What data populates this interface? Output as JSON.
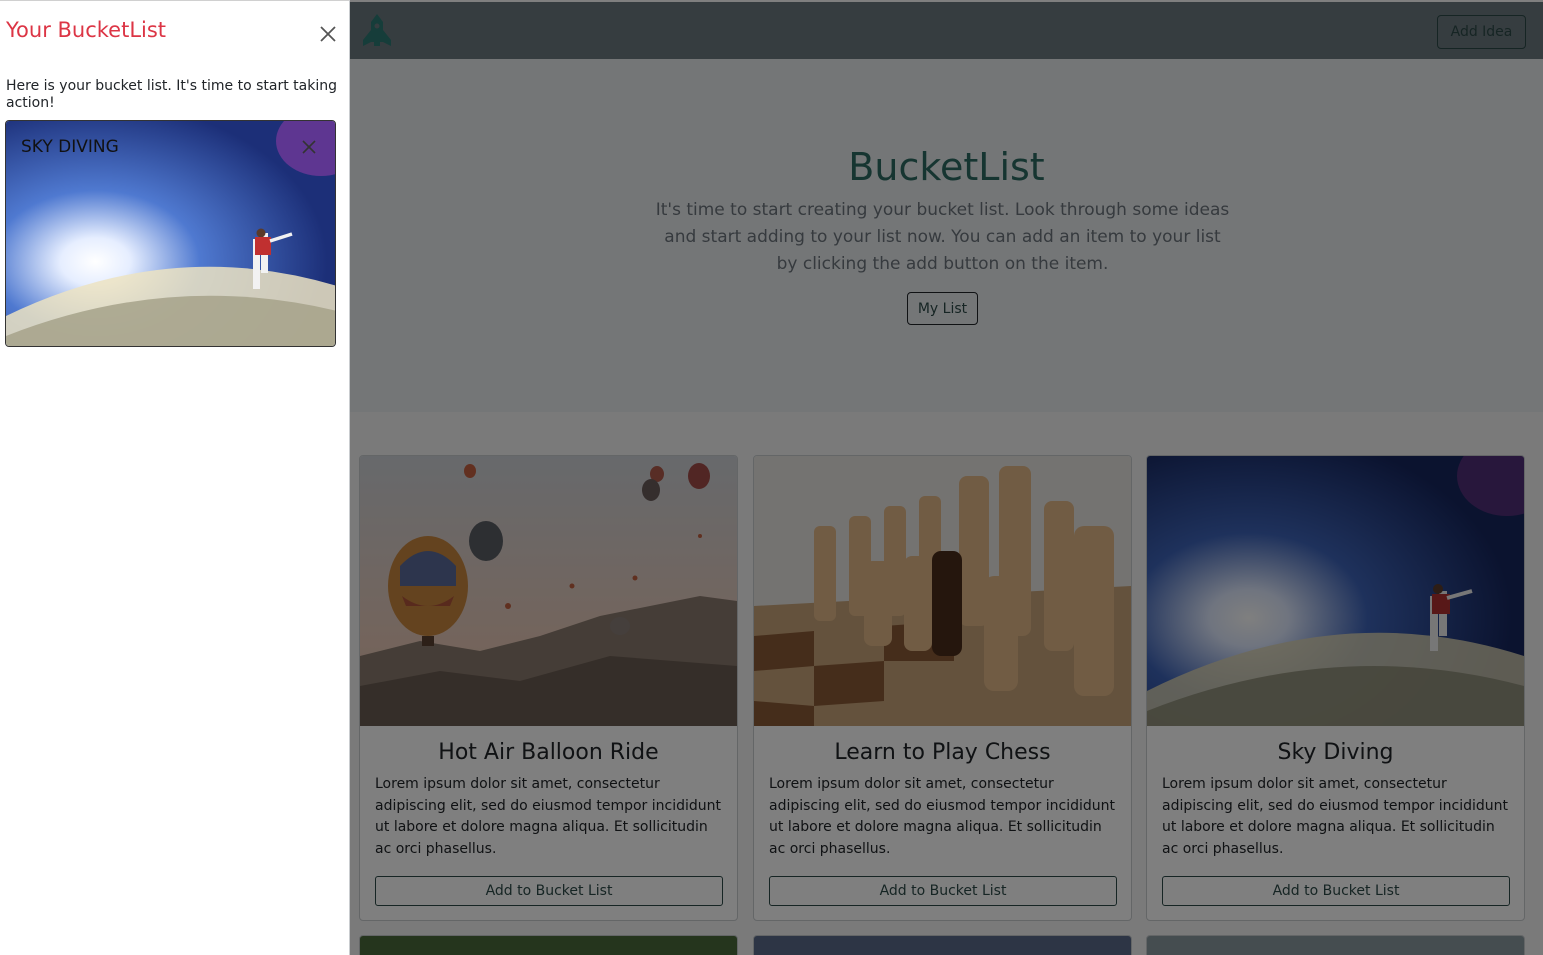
{
  "sidebar": {
    "title": "Your BucketList",
    "description": "Here is your bucket list. It's time to start taking action!",
    "items": [
      {
        "label": "SKY DIVING"
      }
    ]
  },
  "navbar": {
    "add_idea_label": "Add Idea"
  },
  "hero": {
    "title": "BucketList",
    "text": "It's time to start creating your bucket list. Look through some ideas and start adding to your list now. You can add an item to your list by clicking the add button on the item.",
    "my_list_label": "My List"
  },
  "cards": [
    {
      "title": "Hot Air Balloon Ride",
      "text": "Lorem ipsum dolor sit amet, consectetur adipiscing elit, sed do eiusmod tempor incididunt ut labore et dolore magna aliqua. Et sollicitudin ac orci phasellus.",
      "button_label": "Add to Bucket List"
    },
    {
      "title": "Learn to Play Chess",
      "text": "Lorem ipsum dolor sit amet, consectetur adipiscing elit, sed do eiusmod tempor incididunt ut labore et dolore magna aliqua. Et sollicitudin ac orci phasellus.",
      "button_label": "Add to Bucket List"
    },
    {
      "title": "Sky Diving",
      "text": "Lorem ipsum dolor sit amet, consectetur adipiscing elit, sed do eiusmod tempor incididunt ut labore et dolore magna aliqua. Et sollicitudin ac orci phasellus.",
      "button_label": "Add to Bucket List"
    }
  ],
  "colors": {
    "accent_red": "#dc3545",
    "accent_teal": "#2d6b62",
    "navbar": "#6c7a80"
  }
}
